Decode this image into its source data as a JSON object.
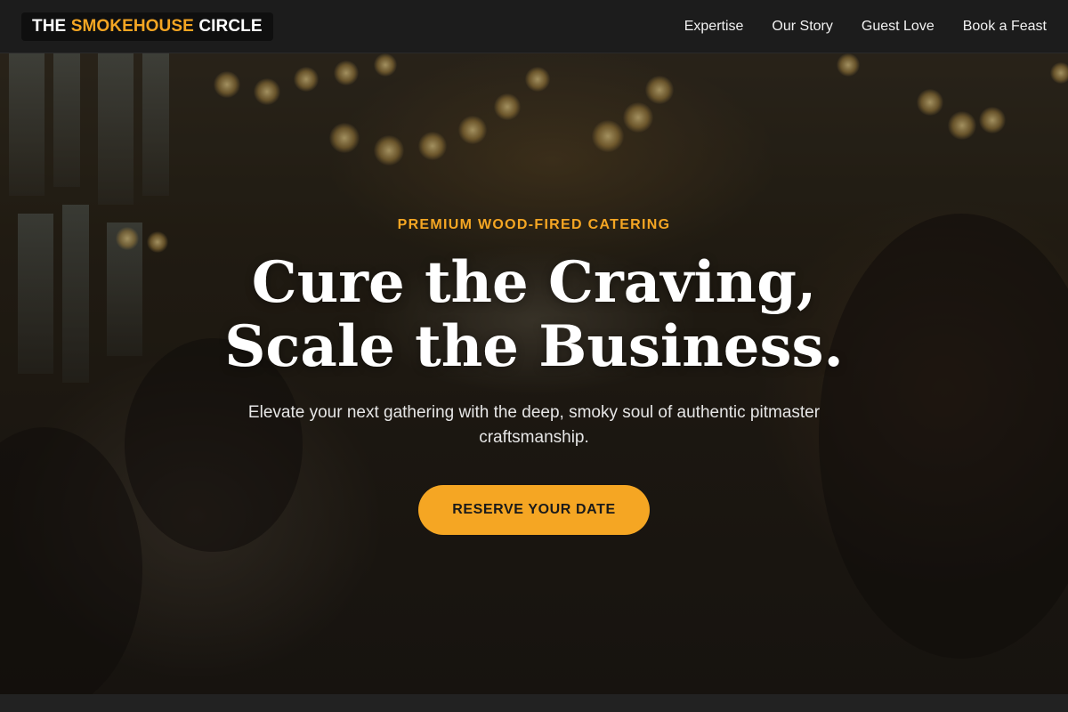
{
  "header": {
    "brand_prefix": "THE ",
    "brand_accent": "SMOKEHOUSE",
    "brand_suffix": " CIRCLE",
    "nav": [
      "Expertise",
      "Our Story",
      "Guest Love",
      "Book a Feast"
    ]
  },
  "hero": {
    "eyebrow": "PREMIUM WOOD-FIRED CATERING",
    "headline": "Cure the Craving, Scale the Business.",
    "subhead": "Elevate your next gathering with the deep, smoky soul of authentic pitmaster craftsmanship.",
    "cta": "RESERVE YOUR DATE",
    "background": "blurred-banquet-photo"
  },
  "colors": {
    "accent": "#f5a623",
    "header_bg": "#1c1c1c",
    "text": "#ffffff"
  }
}
